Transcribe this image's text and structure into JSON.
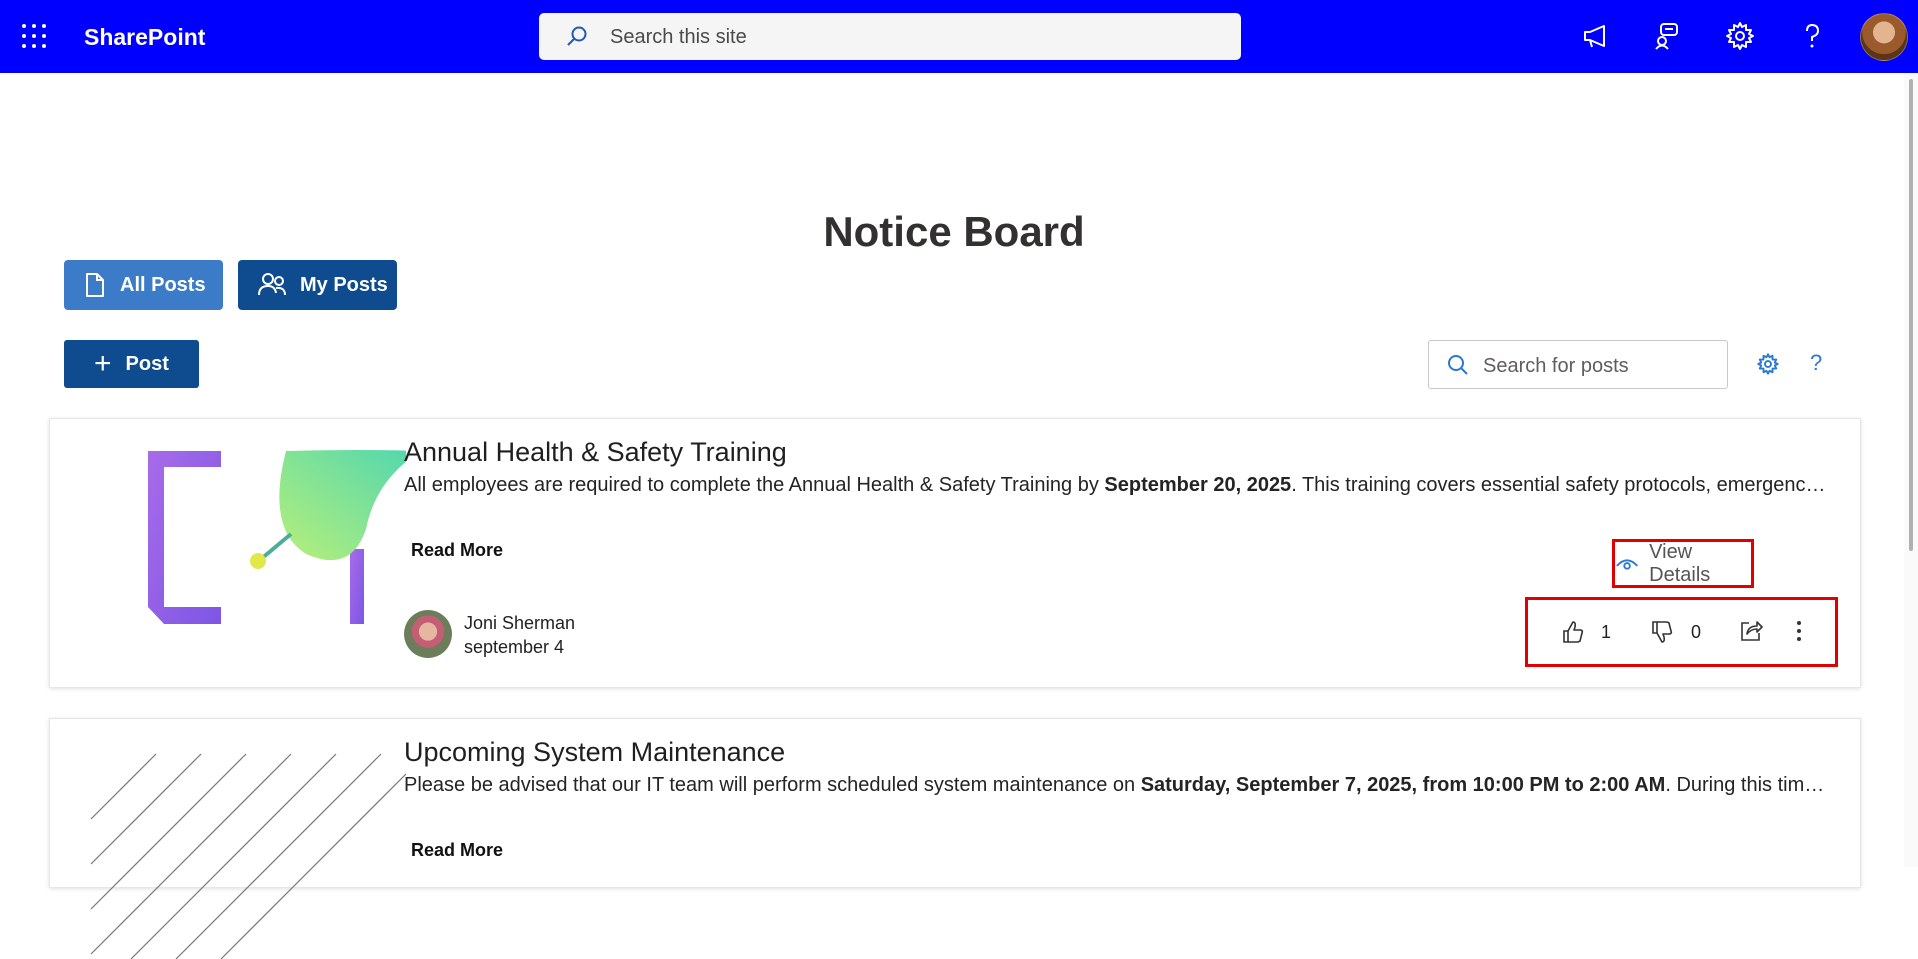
{
  "topbar": {
    "app_name": "SharePoint",
    "search_placeholder": "Search this site",
    "icons": [
      "app-launcher-icon",
      "megaphone-icon",
      "feedback-icon",
      "gear-icon",
      "help-icon",
      "user-avatar"
    ],
    "brand_color": "#0000ff"
  },
  "page": {
    "title": "Notice Board",
    "filters": {
      "all_posts": "All Posts",
      "my_posts": "My Posts"
    },
    "new_post_label": "Post",
    "posts_search_placeholder": "Search for posts",
    "help_label": "?"
  },
  "posts": [
    {
      "title": "Annual Health & Safety Training",
      "desc_before": "All employees are required to complete the Annual Health & Safety Training by ",
      "desc_bold": "September 20, 2025",
      "desc_after": ". This training covers essential safety protocols, emergency procedures, and workplace hazard awareness.",
      "read_more": "Read More",
      "author": "Joni Sherman",
      "date": "september 4",
      "view_details": "View Details",
      "likes": "1",
      "dislikes": "0"
    },
    {
      "title": "Upcoming System Maintenance",
      "desc_before": "Please be advised that our IT team will perform scheduled system maintenance on ",
      "desc_bold": "Saturday, September 7, 2025, from 10:00 PM to 2:00 AM",
      "desc_after": ". During this time, some services may be unavailable.",
      "read_more": "Read More"
    }
  ],
  "colors": {
    "primary_button": "#0f4c8f",
    "active_filter": "#3b7bc8",
    "highlight_box": "#e00000"
  }
}
